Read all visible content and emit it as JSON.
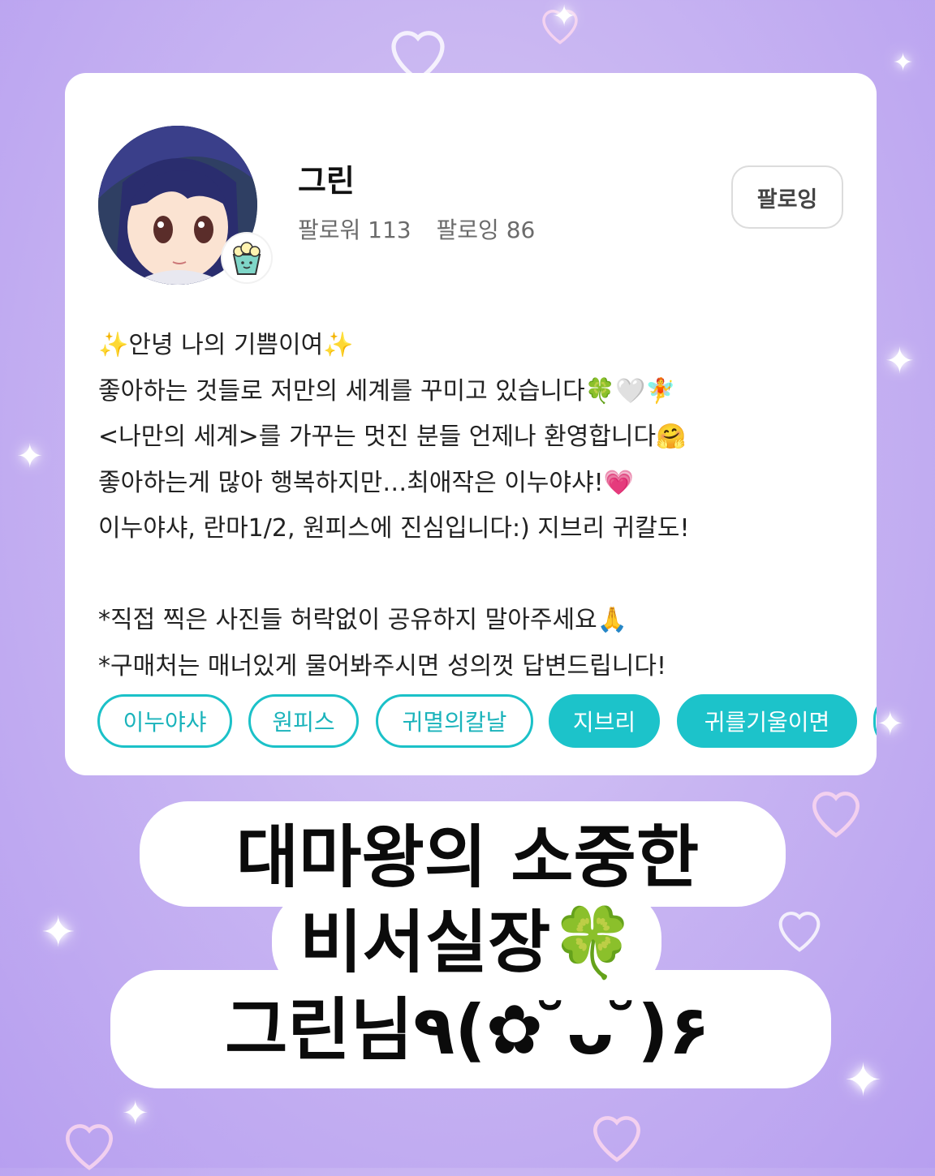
{
  "profile": {
    "name": "그린",
    "followers_label": "팔로워 113",
    "following_label": "팔로잉 86",
    "follow_button": "팔로잉",
    "bio": "✨안녕 나의 기쁨이여✨\n좋아하는 것들로 저만의 세계를 꾸미고 있습니다🍀🤍🧚\n<나만의 세계>를 가꾸는 멋진 분들 언제나 환영합니다🤗\n좋아하는게 많아 행복하지만…최애작은 이누야샤!💗\n이누야샤, 란마1/2, 원피스에 진심입니다:) 지브리 귀칼도!\n\n*직접 찍은 사진들 허락없이 공유하지 말아주세요🙏\n*구매처는 매너있게 물어봐주시면 성의껏 답변드립니다!",
    "tags": [
      "이누야샤",
      "원피스",
      "귀멸의칼날",
      "지브리",
      "귀를기울이면"
    ]
  },
  "caption": {
    "line1": "대마왕의 소중한",
    "line2": "비서실장🍀",
    "line3": "그린님٩(✿ ̆ᴗ ̆)۶"
  },
  "colors": {
    "background": "#c9b6f2",
    "tag_accent": "#1cc3ca",
    "card": "#ffffff"
  }
}
